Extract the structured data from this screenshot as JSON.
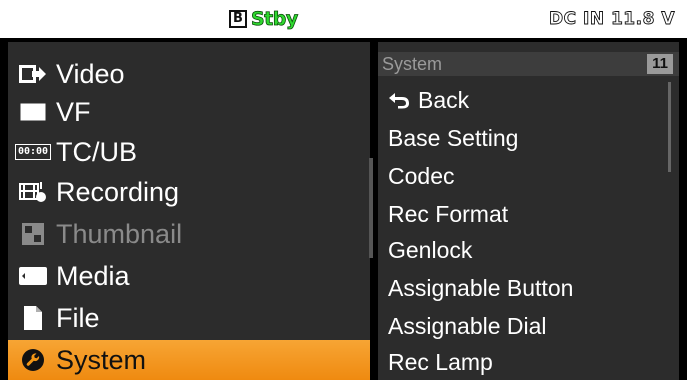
{
  "status": {
    "slot": "B",
    "state": "Stby",
    "power": "DC IN 11.8 V"
  },
  "menu": {
    "items": [
      {
        "label": "Video",
        "icon": "video-output-icon",
        "state": "normal"
      },
      {
        "label": "VF",
        "icon": "viewfinder-icon",
        "state": "normal"
      },
      {
        "label": "TC/UB",
        "icon": "timecode-icon",
        "icon_text": "00:00",
        "state": "normal"
      },
      {
        "label": "Recording",
        "icon": "recording-icon",
        "state": "normal"
      },
      {
        "label": "Thumbnail",
        "icon": "thumbnail-icon",
        "state": "disabled"
      },
      {
        "label": "Media",
        "icon": "media-icon",
        "state": "normal"
      },
      {
        "label": "File",
        "icon": "file-icon",
        "state": "normal"
      },
      {
        "label": "System",
        "icon": "wrench-icon",
        "state": "selected"
      }
    ]
  },
  "submenu": {
    "title": "System",
    "page": "11",
    "items": [
      {
        "label": "Back",
        "icon": "back-arrow-icon"
      },
      {
        "label": "Base Setting"
      },
      {
        "label": "Codec"
      },
      {
        "label": "Rec Format"
      },
      {
        "label": "Genlock"
      },
      {
        "label": "Assignable Button"
      },
      {
        "label": "Assignable Dial"
      },
      {
        "label": "Rec Lamp"
      }
    ]
  },
  "colors": {
    "selected_bg": "#f29616",
    "panel_bg": "#2c2c2c",
    "stby_green": "#2fd82f"
  }
}
